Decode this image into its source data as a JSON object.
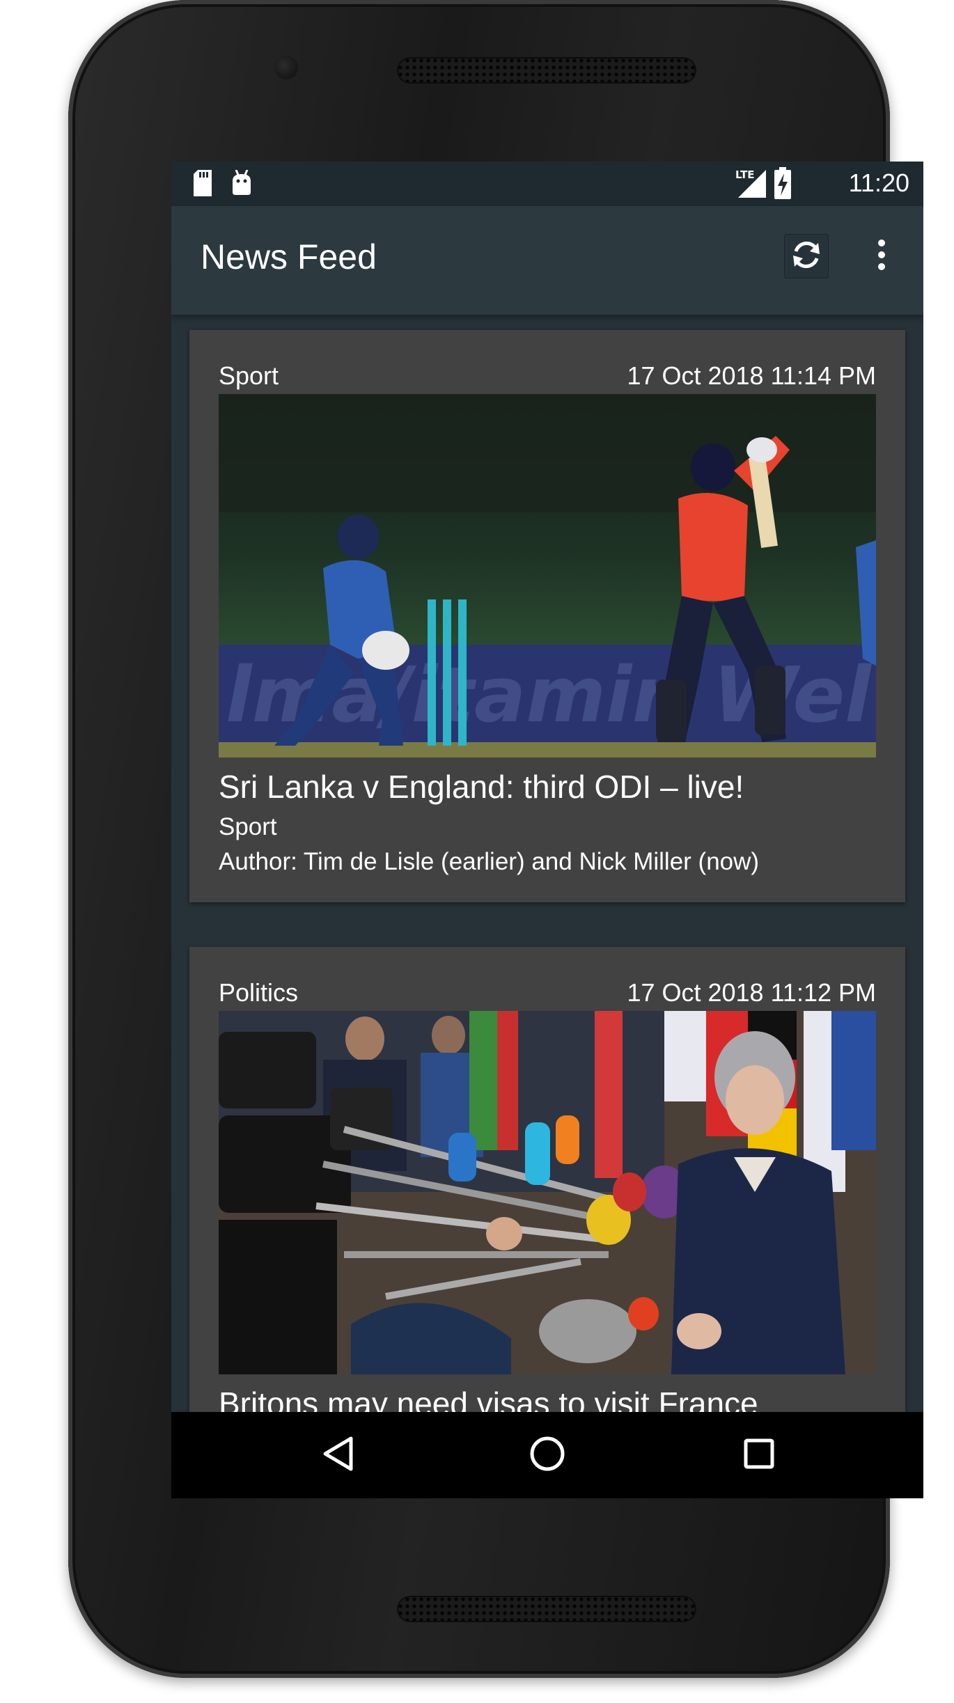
{
  "status_bar": {
    "time": "11:20",
    "icons": [
      "sd-card-icon",
      "android-debug-icon",
      "lte-signal-icon",
      "battery-charging-icon"
    ],
    "network_label": "LTE"
  },
  "app_bar": {
    "title": "News Feed",
    "actions": [
      "refresh-icon",
      "more-vert-icon"
    ]
  },
  "feed": {
    "items": [
      {
        "category": "Sport",
        "date": "17 Oct 2018 11:14 PM",
        "image": "cricket-match-photo",
        "title": "Sri Lanka v England: third ODI – live!",
        "section": "Sport",
        "author": "Author: Tim de Lisle (earlier) and Nick Miller (now)"
      },
      {
        "category": "Politics",
        "date": "17 Oct 2018 11:12 PM",
        "image": "press-conference-photo",
        "title": "Britons may need visas to visit France"
      }
    ]
  },
  "nav_bar": {
    "buttons": [
      "back-icon",
      "home-icon",
      "recents-icon"
    ]
  },
  "colors": {
    "screen_bg": "#263238",
    "app_bar": "#2c393f",
    "status_bar": "#1f2a30",
    "card_bg": "#424242",
    "text": "#ffffff"
  }
}
